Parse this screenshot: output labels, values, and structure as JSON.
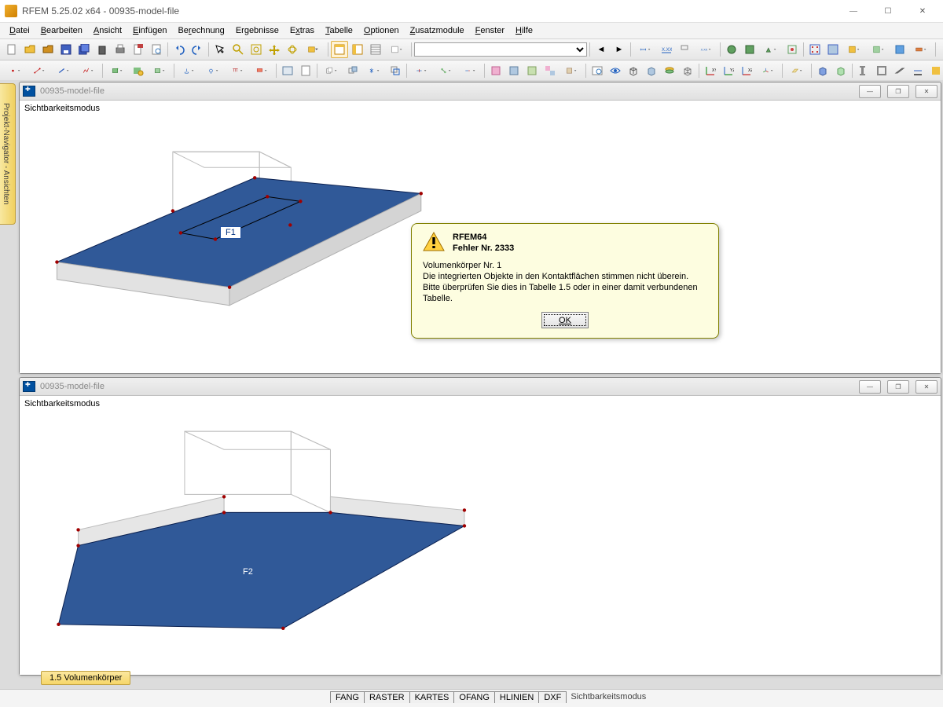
{
  "app": {
    "title": "RFEM 5.25.02 x64 - 00935-model-file",
    "window_buttons": {
      "min": "—",
      "max": "☐",
      "close": "✕"
    }
  },
  "menu": [
    "Datei",
    "Bearbeiten",
    "Ansicht",
    "Einfügen",
    "Berechnung",
    "Ergebnisse",
    "Extras",
    "Tabelle",
    "Optionen",
    "Zusatzmodule",
    "Fenster",
    "Hilfe"
  ],
  "side_tab": "Projekt-Navigator - Ansichten",
  "document": {
    "title": "00935-model-file",
    "mode_label": "Sichtbarkeitsmodus",
    "surface_labels": [
      "F1",
      "F2"
    ],
    "win_buttons": {
      "min": "—",
      "max": "❐",
      "close": "✕"
    }
  },
  "error_dialog": {
    "heading1": "RFEM64",
    "heading2": "Fehler Nr. 2333",
    "line1": "Volumenkörper Nr. 1",
    "line2": "Die integrierten Objekte in den Kontaktflächen stimmen nicht überein.",
    "line3": "Bitte überprüfen Sie dies in Tabelle 1.5 oder in einer damit verbundenen Tabelle.",
    "ok": "OK"
  },
  "bottom_tab": "1.5 Volumenkörper",
  "status_tabs": [
    "FANG",
    "RASTER",
    "KARTES",
    "OFANG",
    "HLINIEN",
    "DXF",
    "Sichtbarkeitsmodus"
  ],
  "colors": {
    "surface": "#305998",
    "surface_edge": "#0a2050",
    "box": "#d8d8d8"
  }
}
